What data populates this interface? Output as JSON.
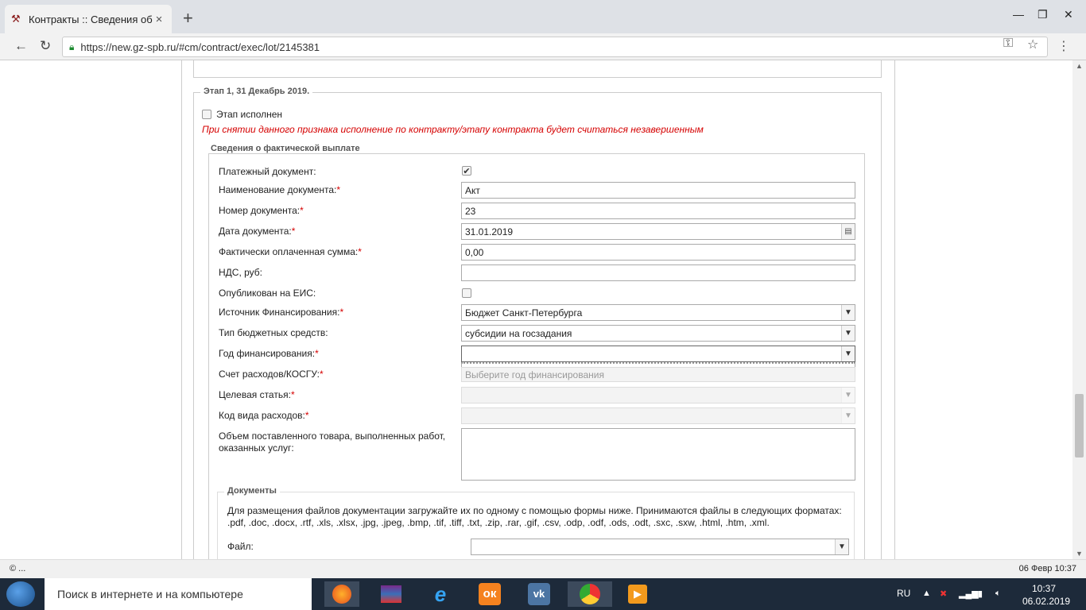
{
  "browser": {
    "tab_title": "Контракты :: Сведения об и",
    "url": "https://new.gz-spb.ru/#cm/contract/exec/lot/2145381"
  },
  "stage": {
    "title": "Этап 1, 31 Декабрь 2019.",
    "done_label": "Этап исполнен",
    "warning": "При снятии данного признака исполнение по контракту/этапу контракта будет считаться незавершенным"
  },
  "payment": {
    "title": "Сведения о фактической выплате",
    "rows": {
      "payment_doc": {
        "label": "Платежный документ:",
        "checked": true
      },
      "doc_name": {
        "label": "Наименование документа:",
        "value": "Акт"
      },
      "doc_number": {
        "label": "Номер документа:",
        "value": "23"
      },
      "doc_date": {
        "label": "Дата документа:",
        "value": "31.01.2019"
      },
      "paid_sum": {
        "label": "Фактически оплаченная сумма:",
        "value": "0,00"
      },
      "vat": {
        "label": "НДС, руб:",
        "value": ""
      },
      "published": {
        "label": "Опубликован на ЕИС:",
        "checked": false
      },
      "fin_source": {
        "label": "Источник Финансирования:",
        "value": "Бюджет Санкт-Петербурга"
      },
      "budget_type": {
        "label": "Тип бюджетных средств:",
        "value": "субсидии на госзадания"
      },
      "fin_year": {
        "label": "Год финансирования:",
        "value": ""
      },
      "kosgu": {
        "label": "Счет расходов/КОСГУ:",
        "placeholder": "Выберите год финансирования"
      },
      "target_article": {
        "label": "Целевая статья:",
        "value": ""
      },
      "expense_code": {
        "label": "Код вида расходов:",
        "value": ""
      },
      "volume": {
        "label": "Объем поставленного товара, выполненных работ, оказанных услуг:",
        "value": ""
      }
    },
    "required_mark": "*"
  },
  "documents": {
    "title": "Документы",
    "text": "Для размещения файлов документации загружайте их по одному с помощью формы ниже. Принимаются файлы в следующих форматах: .pdf, .doc, .docx, .rtf, .xls, .xlsx, .jpg, .jpeg, .bmp, .tif, .tiff, .txt, .zip, .rar, .gif, .csv, .odp, .odf, .ods, .odt, .sxc, .sxw, .html, .htm, .xml.",
    "file_label": "Файл:"
  },
  "statusbar": {
    "left": "© ...",
    "right": "06 Февр 10:37"
  },
  "taskbar": {
    "search_placeholder": "Поиск в интернете и на компьютере",
    "lang": "RU",
    "time": "10:37",
    "date": "06.02.2019"
  },
  "colors": {
    "required": "#d50000",
    "taskbar_bg": "#1d2a3a"
  }
}
